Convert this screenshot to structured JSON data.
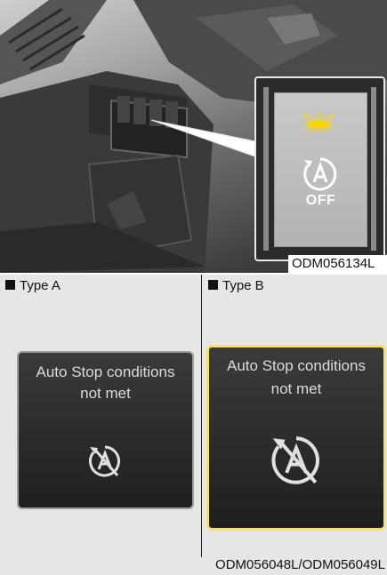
{
  "photo": {
    "code": "ODM056134L",
    "button_label": "OFF",
    "icon": "auto-stop-a-icon",
    "indicator_color": "#ffd400"
  },
  "type_a": {
    "label": "Type A",
    "message": "Auto Stop conditions not met",
    "icon": "auto-stop-disabled-icon"
  },
  "type_b": {
    "label": "Type B",
    "message": "Auto Stop conditions not met",
    "icon": "auto-stop-disabled-icon",
    "border_color": "#f3e26a"
  },
  "footer": {
    "code": "ODM056048L/ODM056049L"
  }
}
